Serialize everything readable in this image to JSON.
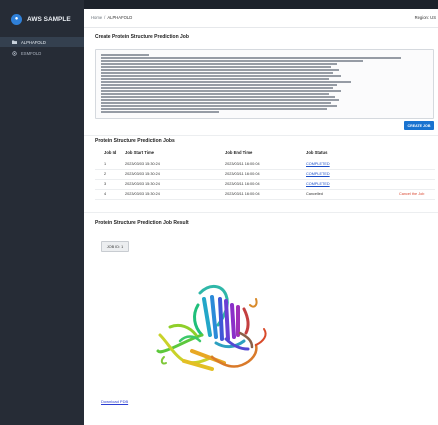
{
  "sidebar": {
    "brand": "AWS SAMPLE",
    "items": [
      {
        "label": "ALPHAFOLD"
      },
      {
        "label": "ESMFOLD"
      }
    ]
  },
  "topbar": {
    "breadcrumb": [
      "Home",
      "ALPHAFOLD"
    ],
    "region": "Region: US"
  },
  "create": {
    "title": "Create Protein Structure Prediction Job",
    "button": "CREATE JOB"
  },
  "jobs": {
    "title": "Protein Structure Prediction Jobs",
    "columns": [
      "Job Id",
      "Job Start Time",
      "Job End Time",
      "Job Status",
      ""
    ],
    "rows": [
      {
        "id": "1",
        "start": "2023/03/03 15:30:24",
        "end": "2023/03/11 16:00:04",
        "status": "COMPLETED",
        "action": ""
      },
      {
        "id": "2",
        "start": "2023/03/03 15:30:24",
        "end": "2023/03/11 16:00:04",
        "status": "COMPLETED",
        "action": ""
      },
      {
        "id": "3",
        "start": "2023/03/03 15:30:24",
        "end": "2023/03/11 16:00:04",
        "status": "COMPLETED",
        "action": ""
      },
      {
        "id": "4",
        "start": "2023/03/03 15:30:24",
        "end": "2023/03/11 16:00:04",
        "status": "Cancelled",
        "action": "Cancel the Job"
      }
    ]
  },
  "result": {
    "title": "Protein Structure Prediction Job Result",
    "selected_job": "JOB ID: 1",
    "download": "Download PDB"
  },
  "colors": {
    "sidebar_bg": "#262c36",
    "primary": "#1a73d0",
    "link": "#1a4ec8",
    "danger": "#d9452e"
  }
}
